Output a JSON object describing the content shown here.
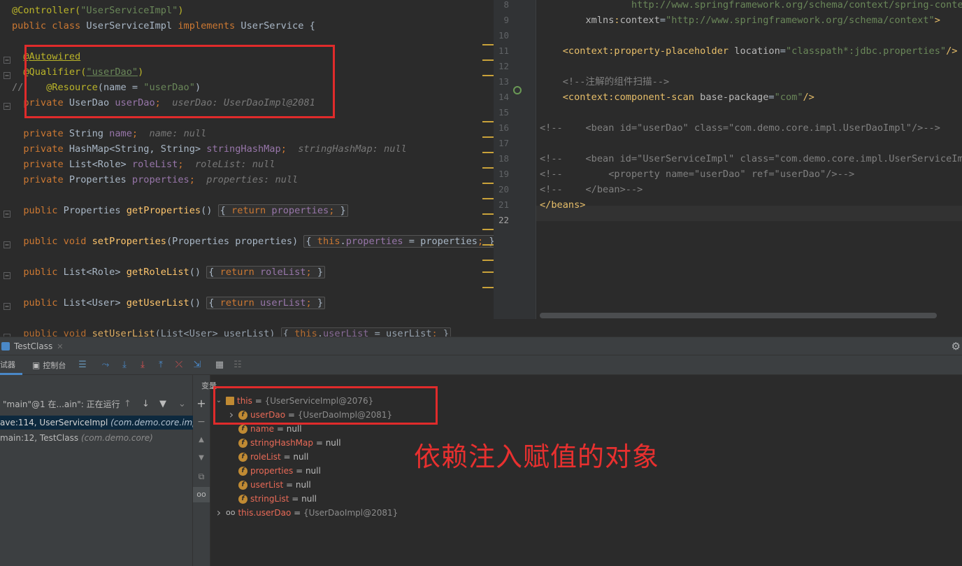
{
  "left_editor": {
    "lines": [
      {
        "parts": [
          [
            "ann",
            "@Controller("
          ],
          [
            "str",
            "\"UserServiceImpl\""
          ],
          [
            "ann",
            ")"
          ]
        ]
      },
      {
        "parts": [
          [
            "kw",
            "public class "
          ],
          [
            "",
            "UserServiceImpl "
          ],
          [
            "kw",
            "implements "
          ],
          [
            "",
            "UserService {"
          ]
        ]
      },
      {
        "parts": [
          [
            "",
            ""
          ]
        ]
      },
      {
        "parts": [
          [
            "",
            "  "
          ],
          [
            "ann ul",
            "@Autowired"
          ]
        ]
      },
      {
        "parts": [
          [
            "",
            "  "
          ],
          [
            "ann",
            "@Qualifier("
          ],
          [
            "str ul",
            "\"userDao\""
          ],
          [
            "ann",
            ")"
          ]
        ]
      },
      {
        "parts": [
          [
            "cmt",
            "//    "
          ],
          [
            "ann",
            "@Resource"
          ],
          [
            "",
            "(name = "
          ],
          [
            "str",
            "\"userDao\""
          ],
          [
            "",
            ")"
          ]
        ],
        "no_indent": true
      },
      {
        "parts": [
          [
            "",
            "  "
          ],
          [
            "kw",
            "private "
          ],
          [
            "",
            "UserDao "
          ],
          [
            "fld",
            "userDao"
          ],
          [
            "kw",
            ";"
          ],
          [
            "",
            "  "
          ],
          [
            "hint",
            "userDao: UserDaoImpl@2081"
          ]
        ]
      },
      {
        "parts": [
          [
            "",
            ""
          ]
        ]
      },
      {
        "parts": [
          [
            "",
            "  "
          ],
          [
            "kw",
            "private "
          ],
          [
            "",
            "String "
          ],
          [
            "fld",
            "name"
          ],
          [
            "kw",
            ";"
          ],
          [
            "",
            "  "
          ],
          [
            "hint",
            "name: null"
          ]
        ]
      },
      {
        "parts": [
          [
            "",
            "  "
          ],
          [
            "kw",
            "private "
          ],
          [
            "",
            "HashMap<String, String> "
          ],
          [
            "fld",
            "stringHashMap"
          ],
          [
            "kw",
            ";"
          ],
          [
            "",
            "  "
          ],
          [
            "hint",
            "stringHashMap: null"
          ]
        ]
      },
      {
        "parts": [
          [
            "",
            "  "
          ],
          [
            "kw",
            "private "
          ],
          [
            "",
            "List<Role> "
          ],
          [
            "fld",
            "roleList"
          ],
          [
            "kw",
            ";"
          ],
          [
            "",
            "  "
          ],
          [
            "hint",
            "roleList: null"
          ]
        ]
      },
      {
        "parts": [
          [
            "",
            "  "
          ],
          [
            "kw",
            "private "
          ],
          [
            "",
            "Properties "
          ],
          [
            "fld",
            "properties"
          ],
          [
            "kw",
            ";"
          ],
          [
            "",
            "  "
          ],
          [
            "hint",
            "properties: null"
          ]
        ]
      },
      {
        "parts": [
          [
            "",
            ""
          ]
        ]
      },
      {
        "parts": [
          [
            "",
            "  "
          ],
          [
            "kw",
            "public "
          ],
          [
            "",
            "Properties "
          ],
          [
            "mth",
            "getProperties"
          ],
          [
            "",
            "() "
          ],
          [
            "box",
            "{ <kw>return</kw> <fld>properties</fld><kw>;</kw> }"
          ]
        ]
      },
      {
        "parts": [
          [
            "",
            ""
          ]
        ]
      },
      {
        "parts": [
          [
            "",
            "  "
          ],
          [
            "kw",
            "public void "
          ],
          [
            "mth",
            "setProperties"
          ],
          [
            "",
            "(Properties properties) "
          ],
          [
            "box",
            "{ <kw>this</kw>.<fld>properties</fld> = properties<kw>;</kw> }"
          ]
        ]
      },
      {
        "parts": [
          [
            "",
            ""
          ]
        ]
      },
      {
        "parts": [
          [
            "",
            "  "
          ],
          [
            "kw",
            "public "
          ],
          [
            "",
            "List<Role> "
          ],
          [
            "mth",
            "getRoleList"
          ],
          [
            "",
            "() "
          ],
          [
            "box",
            "{ <kw>return</kw> <fld>roleList</fld><kw>;</kw> }"
          ]
        ]
      },
      {
        "parts": [
          [
            "",
            ""
          ]
        ]
      },
      {
        "parts": [
          [
            "",
            "  "
          ],
          [
            "kw",
            "public "
          ],
          [
            "",
            "List<User> "
          ],
          [
            "mth",
            "getUserList"
          ],
          [
            "",
            "() "
          ],
          [
            "box",
            "{ <kw>return</kw> <fld>userList</fld><kw>;</kw> }"
          ]
        ]
      },
      {
        "parts": [
          [
            "",
            ""
          ]
        ]
      },
      {
        "parts": [
          [
            "",
            "  "
          ],
          [
            "kw",
            "public void "
          ],
          [
            "mth",
            "setUserList"
          ],
          [
            "",
            "(List<User> userList) "
          ],
          [
            "box",
            "{ <kw>this</kw>.<fld>userList</fld> = userList<kw>;</kw> }"
          ]
        ]
      }
    ]
  },
  "right_editor": {
    "line_numbers": [
      "8",
      "9",
      "10",
      "11",
      "12",
      "13",
      "14",
      "15",
      "16",
      "17",
      "18",
      "19",
      "20",
      "21",
      "22"
    ],
    "lines": [
      {
        "parts": [
          [
            "str",
            "                http://www.springframework.org/schema/context/spring-context.xsd"
          ]
        ]
      },
      {
        "parts": [
          [
            "",
            "        "
          ],
          [
            "attr",
            "xmlns"
          ],
          [
            "tag",
            ":"
          ],
          [
            "attr",
            "context"
          ],
          [
            "",
            "="
          ],
          [
            "str",
            "\"http://www.springframework.org/schema/context\""
          ],
          [
            "tag",
            ">"
          ]
        ]
      },
      {
        "parts": [
          [
            "",
            ""
          ]
        ]
      },
      {
        "parts": [
          [
            "",
            "    "
          ],
          [
            "tag",
            "<context:property-placeholder "
          ],
          [
            "attr",
            "location"
          ],
          [
            "",
            "="
          ],
          [
            "str",
            "\"classpath*:jdbc.properties\""
          ],
          [
            "tag",
            "/>"
          ]
        ]
      },
      {
        "parts": [
          [
            "",
            ""
          ]
        ]
      },
      {
        "parts": [
          [
            "",
            "    "
          ],
          [
            "cmt",
            "<!--注解的组件扫描-->"
          ]
        ]
      },
      {
        "parts": [
          [
            "",
            "    "
          ],
          [
            "tag",
            "<context:component-scan "
          ],
          [
            "attr",
            "base-package"
          ],
          [
            "",
            "="
          ],
          [
            "str",
            "\"com\""
          ],
          [
            "tag",
            "/>"
          ]
        ]
      },
      {
        "parts": [
          [
            "",
            ""
          ]
        ]
      },
      {
        "parts": [
          [
            "cmt",
            "<!--    <bean id=\"userDao\" class=\"com.demo.core.impl.UserDaoImpl\"/>-->"
          ]
        ]
      },
      {
        "parts": [
          [
            "",
            ""
          ]
        ]
      },
      {
        "parts": [
          [
            "cmt",
            "<!--    <bean id=\"UserServiceImpl\" class=\"com.demo.core.impl.UserServiceImpl\">"
          ]
        ]
      },
      {
        "parts": [
          [
            "cmt",
            "<!--        <property name=\"userDao\" ref=\"userDao\"/>-->"
          ]
        ]
      },
      {
        "parts": [
          [
            "cmt",
            "<!--    </bean>-->"
          ]
        ]
      },
      {
        "parts": [
          [
            "tag",
            "</beans>"
          ]
        ]
      },
      {
        "parts": [
          [
            "",
            ""
          ]
        ]
      }
    ]
  },
  "debug": {
    "tab_title": "TestClass",
    "toolbar": {
      "debugger_label": "试器",
      "console_label": "控制台"
    },
    "thread": {
      "label": "\"main\"@1 在...ain\": 正在运行"
    },
    "frames": [
      {
        "method": "ave:114, UserServiceImpl",
        "pkg": "(com.demo.core.impl)"
      },
      {
        "method": "main:12, TestClass",
        "pkg": "(com.demo.core)"
      }
    ],
    "variables_title": "变量",
    "variables": [
      {
        "name": "this",
        "eq": " = ",
        "value": "{UserServiceImpl@2076}",
        "kind": "object",
        "arrow": "v",
        "indent": 0
      },
      {
        "name": "userDao",
        "eq": " = ",
        "value": "{UserDaoImpl@2081}",
        "kind": "field",
        "arrow": ">",
        "indent": 1
      },
      {
        "name": "name",
        "eq": " = ",
        "value": "null",
        "kind": "field",
        "arrow": "",
        "indent": 1
      },
      {
        "name": "stringHashMap",
        "eq": " = ",
        "value": "null",
        "kind": "field",
        "arrow": "",
        "indent": 1
      },
      {
        "name": "roleList",
        "eq": " = ",
        "value": "null",
        "kind": "field",
        "arrow": "",
        "indent": 1
      },
      {
        "name": "properties",
        "eq": " = ",
        "value": "null",
        "kind": "field",
        "arrow": "",
        "indent": 1
      },
      {
        "name": "userList",
        "eq": " = ",
        "value": "null",
        "kind": "field",
        "arrow": "",
        "indent": 1
      },
      {
        "name": "stringList",
        "eq": " = ",
        "value": "null",
        "kind": "field",
        "arrow": "",
        "indent": 1
      },
      {
        "name": "this.userDao",
        "eq": " = ",
        "value": "{UserDaoImpl@2081}",
        "kind": "watch",
        "arrow": ">",
        "indent": 0
      }
    ]
  },
  "annotation": {
    "text": "依赖注入赋值的对象"
  },
  "colors": {
    "highlight_red": "#e02b2b",
    "selected_frame": "#0d293e",
    "field_badge": "#c08a33"
  }
}
